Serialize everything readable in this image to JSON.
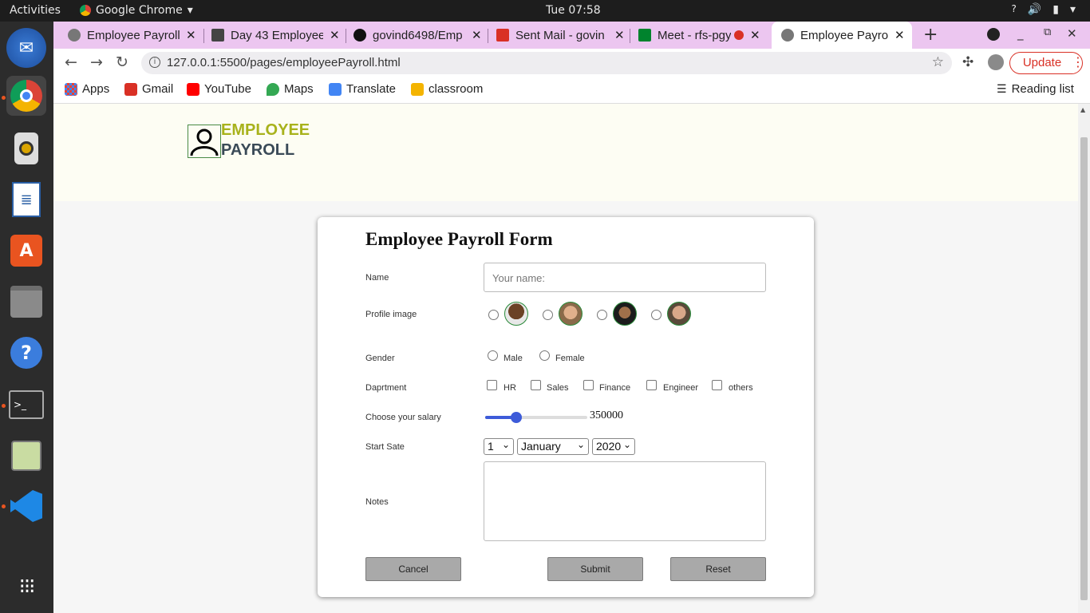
{
  "system": {
    "activities": "Activities",
    "app_name": "Google Chrome",
    "clock": "Tue 07:58"
  },
  "browser": {
    "tabs": [
      {
        "label": "Employee Payroll"
      },
      {
        "label": "Day 43 Employee"
      },
      {
        "label": "govind6498/Emp"
      },
      {
        "label": "Sent Mail - govin"
      },
      {
        "label": "Meet - rfs-pgy"
      },
      {
        "label": "Employee Payroll"
      }
    ],
    "url": "127.0.0.1:5500/pages/employeePayroll.html",
    "update_label": "Update",
    "bookmarks": [
      {
        "label": "Apps"
      },
      {
        "label": "Gmail"
      },
      {
        "label": "YouTube"
      },
      {
        "label": "Maps"
      },
      {
        "label": "Translate"
      },
      {
        "label": "classroom"
      }
    ],
    "reading_list": "Reading list"
  },
  "header": {
    "logo_line1": "EMPLOYEE",
    "logo_line2": "PAYROLL"
  },
  "form": {
    "title": "Employee Payroll Form",
    "name_label": "Name",
    "name_placeholder": "Your name:",
    "profile_label": "Profile image",
    "gender_label": "Gender",
    "gender_options": [
      "Male",
      "Female"
    ],
    "department_label": "Daprtment",
    "department_options": [
      "HR",
      "Sales",
      "Finance",
      "Engineer",
      "others"
    ],
    "salary_label": "Choose your salary",
    "salary_value": "350000",
    "salary_slider_fraction": 0.28,
    "start_label": "Start Sate",
    "start_day": "1",
    "start_month": "January",
    "start_year": "2020",
    "notes_label": "Notes",
    "cancel_label": "Cancel",
    "submit_label": "Submit",
    "reset_label": "Reset"
  },
  "colors": {
    "tab_strip": "#ecc6f0",
    "accent_logo": "#a8b21c",
    "slider": "#3d5bd9",
    "update": "#d93025"
  }
}
